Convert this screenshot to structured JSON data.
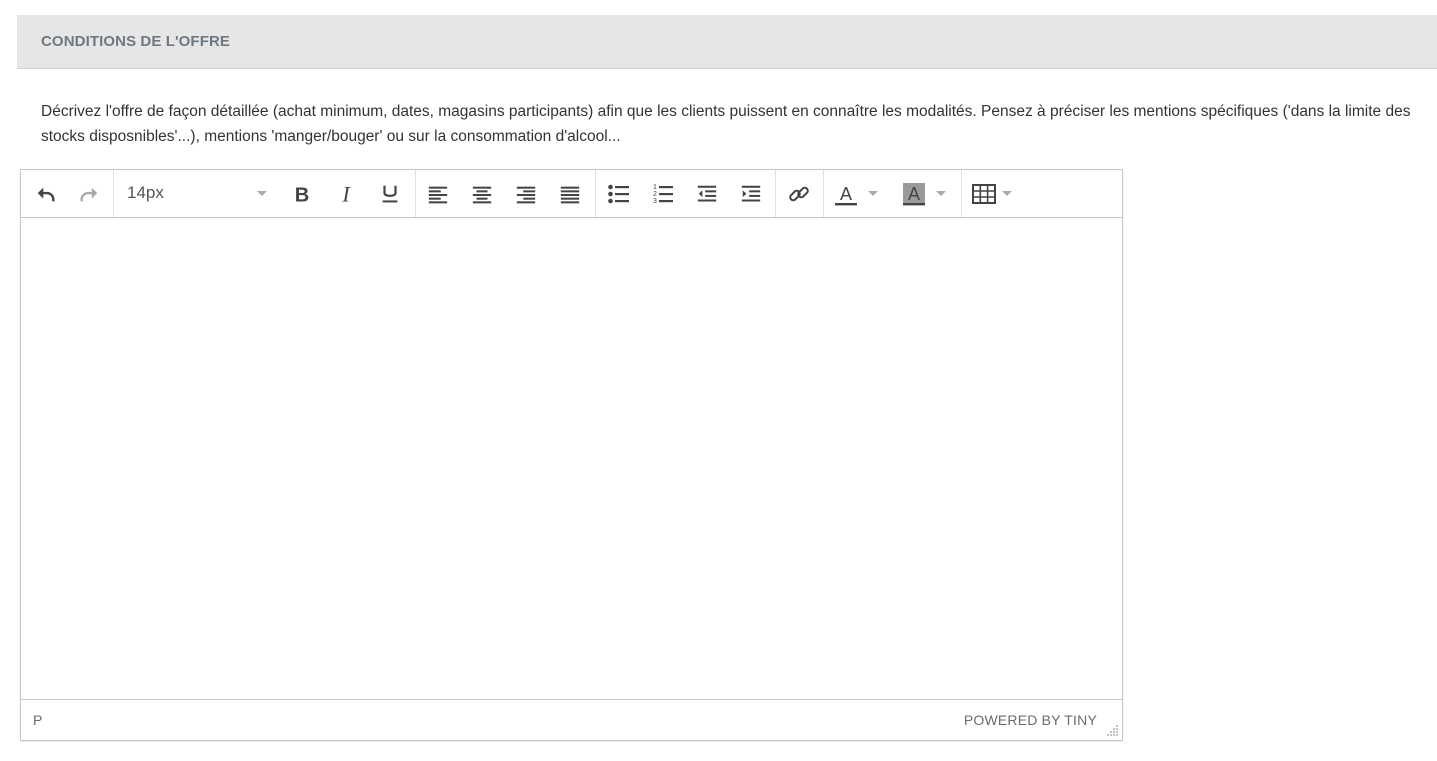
{
  "section": {
    "title": "CONDITIONS DE L'OFFRE",
    "description": "Décrivez l'offre de façon détaillée (achat minimum, dates, magasins participants) afin que les clients puissent en connaître les modalités. Pensez à préciser les mentions spécifiques ('dans la limite des stocks disposnibles'...), mentions 'manger/bouger' ou sur la consommation d'alcool..."
  },
  "editor": {
    "font_size": "14px",
    "toolbar_icons": [
      "undo-icon",
      "redo-icon",
      "bold-icon",
      "italic-icon",
      "underline-icon",
      "align-left-icon",
      "align-center-icon",
      "align-right-icon",
      "align-justify-icon",
      "bullet-list-icon",
      "numbered-list-icon",
      "outdent-icon",
      "indent-icon",
      "link-icon",
      "text-color-icon",
      "background-color-icon",
      "table-icon"
    ],
    "content": "",
    "status_path": "P",
    "branding": "POWERED BY TINY"
  },
  "colors": {
    "header_bg": "#e6e6e6",
    "header_text": "#6f7780",
    "icon": "#444444",
    "icon_disabled": "#aaaaaa"
  }
}
